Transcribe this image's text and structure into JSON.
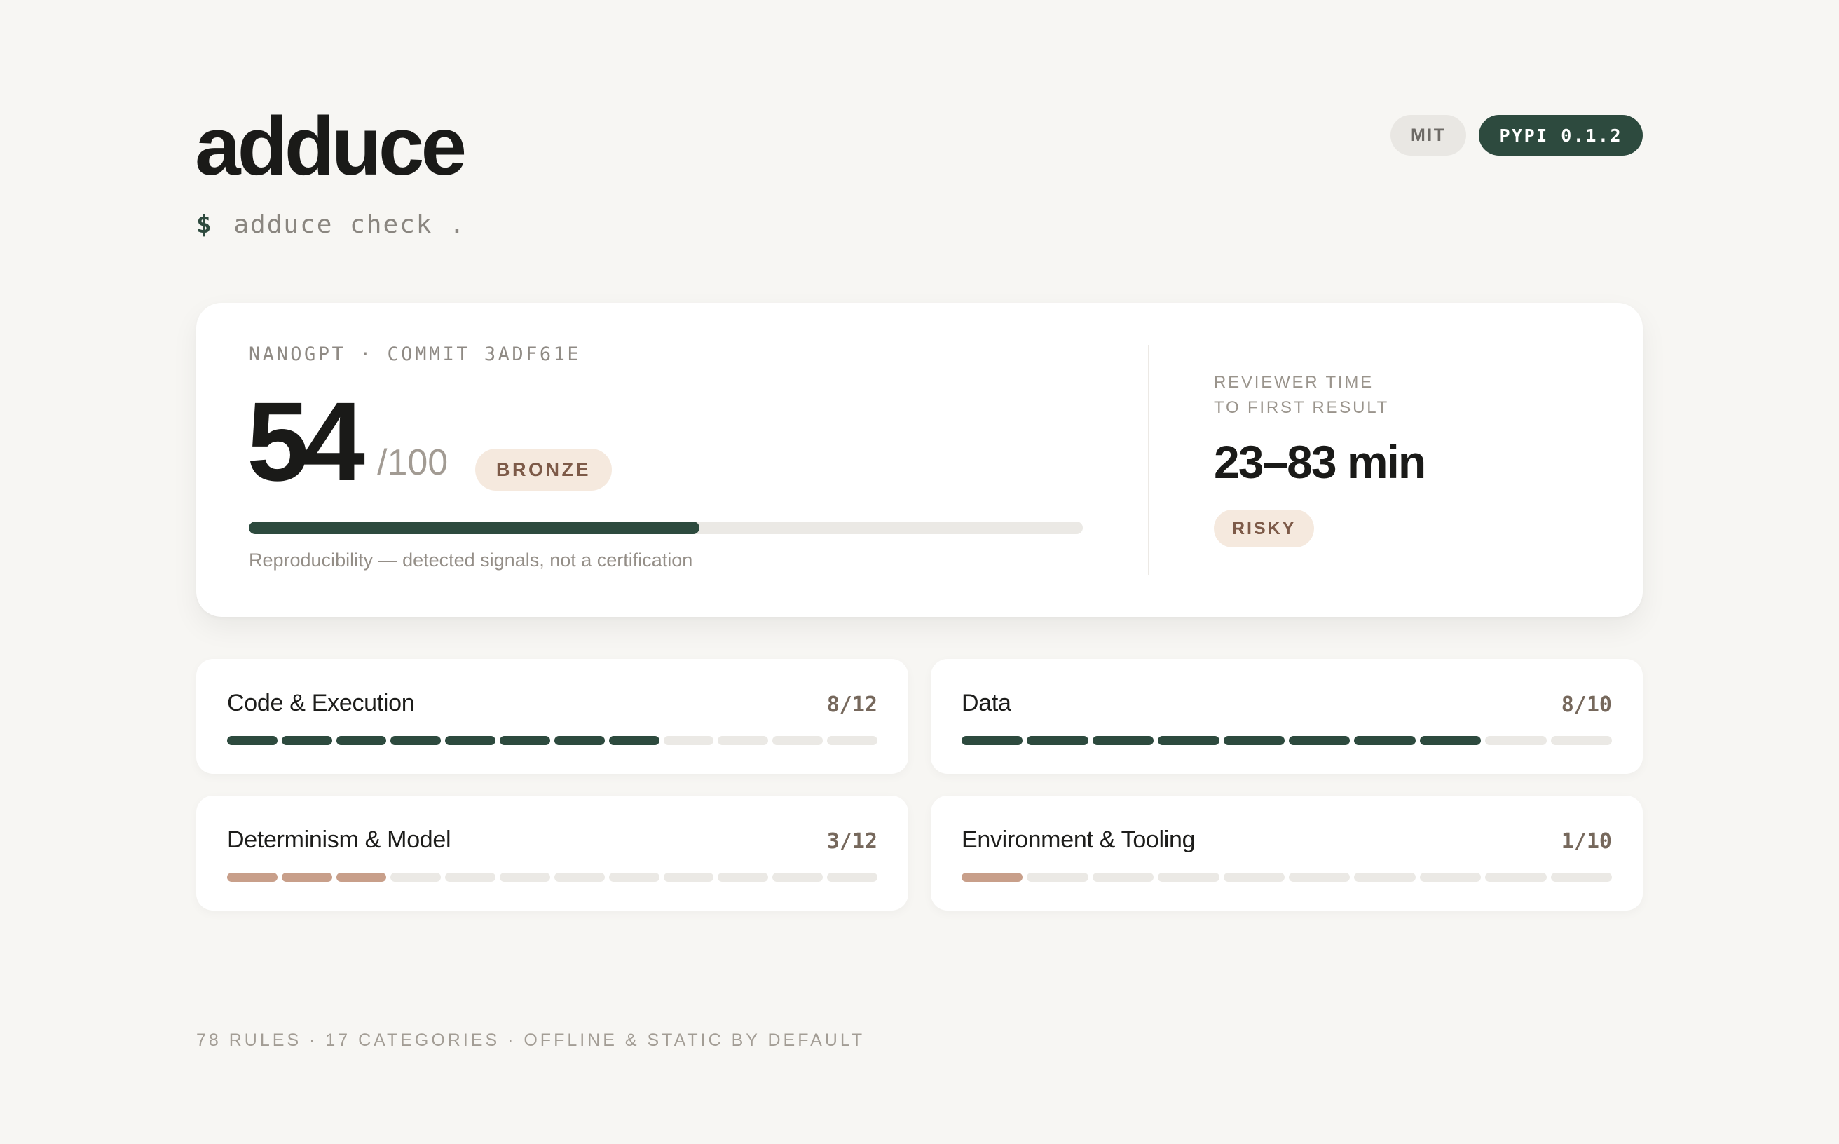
{
  "header": {
    "title": "adduce",
    "prompt": "$",
    "command": "adduce check ."
  },
  "badges": [
    {
      "label": "MIT"
    },
    {
      "label": "PYPI 0.1.2"
    }
  ],
  "score_card": {
    "repo_label": "NANOGPT · COMMIT 3ADF61E",
    "score": "54",
    "max": "/100",
    "tier": "BRONZE",
    "progress_fraction": 0.54,
    "note": "Reproducibility — detected signals, not a certification",
    "reviewer_label_line1": "REVIEWER TIME",
    "reviewer_label_line2": "TO FIRST RESULT",
    "reviewer_time": "23–83 min",
    "risk": "RISKY"
  },
  "categories": [
    {
      "name": "Code & Execution",
      "score": "8/12",
      "filled": 8,
      "total": 12,
      "color": "#2d4a3e"
    },
    {
      "name": "Data",
      "score": "8/10",
      "filled": 8,
      "total": 10,
      "color": "#2d4a3e"
    },
    {
      "name": "Determinism & Model",
      "score": "3/12",
      "filled": 3,
      "total": 12,
      "color": "#c89f8a"
    },
    {
      "name": "Environment & Tooling",
      "score": "1/10",
      "filled": 1,
      "total": 10,
      "color": "#c89f8a"
    }
  ],
  "footer": {
    "text": "78 RULES · 17 CATEGORIES · OFFLINE & STATIC BY DEFAULT"
  },
  "colors": {
    "accent_green": "#2d4a3e",
    "accent_rose": "#c89f8a",
    "tier_bg": "#f5e9de",
    "background": "#f7f6f3"
  }
}
